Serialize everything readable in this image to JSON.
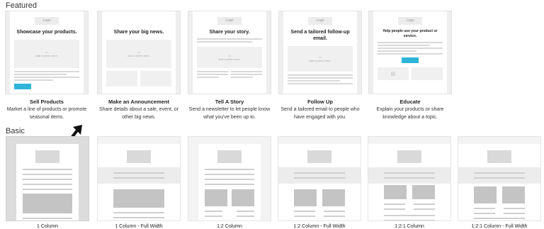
{
  "sections": {
    "featured": "Featured",
    "basic": "Basic"
  },
  "featured": [
    {
      "name": "Sell Products",
      "desc": "Market a line of products or promote seasonal items.",
      "thumb_head": "Showcase your products."
    },
    {
      "name": "Make an Announcement",
      "desc": "Share details about a sale, event, or other big news.",
      "thumb_head": "Share your big news."
    },
    {
      "name": "Tell A Story",
      "desc": "Send a newsletter to let people know what you've been up to.",
      "thumb_head": "Share your story."
    },
    {
      "name": "Follow Up",
      "desc": "Send a tailored email to people who have engaged with you.",
      "thumb_head": "Send a tailored follow-up email."
    },
    {
      "name": "Educate",
      "desc": "Explain your products or share knowledge about a topic.",
      "thumb_head": "Help people use your product or service."
    }
  ],
  "thumb_labels": {
    "logo": "Logo",
    "photo": "Add a photo here."
  },
  "basic": [
    {
      "name": "1 Column"
    },
    {
      "name": "1 Column - Full Width"
    },
    {
      "name": "1:2 Column"
    },
    {
      "name": "1:2 Column - Full Width"
    },
    {
      "name": "1:2:1 Column"
    },
    {
      "name": "1:2:1 Column - Full Width"
    }
  ],
  "colors": {
    "button": "#2db5d8",
    "selected_bg": "#dcdcdc"
  },
  "icons": {
    "pointer": "arrow-pointer-icon"
  }
}
